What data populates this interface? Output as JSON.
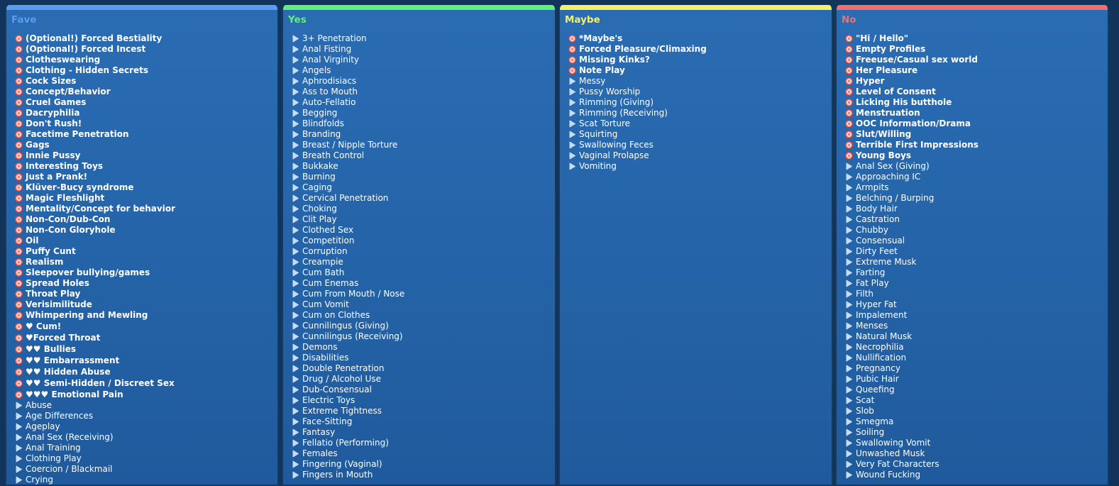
{
  "columns": [
    {
      "id": "fave",
      "title": "Fave",
      "color": "#5b9bf0",
      "items": [
        {
          "label": "(Optional!) Forced Bestiality",
          "bold": true,
          "icon": "red-circle-icon"
        },
        {
          "label": "(Optional!) Forced Incest",
          "bold": true,
          "icon": "red-circle-icon"
        },
        {
          "label": "Clotheswearing",
          "bold": true,
          "icon": "red-circle-icon"
        },
        {
          "label": "Clothing - Hidden Secrets",
          "bold": true,
          "icon": "red-circle-icon"
        },
        {
          "label": "Cock Sizes",
          "bold": true,
          "icon": "red-circle-icon"
        },
        {
          "label": "Concept/Behavior",
          "bold": true,
          "icon": "red-circle-icon"
        },
        {
          "label": "Cruel Games",
          "bold": true,
          "icon": "red-circle-icon"
        },
        {
          "label": "Dacryphilia",
          "bold": true,
          "icon": "red-circle-icon"
        },
        {
          "label": "Don't Rush!",
          "bold": true,
          "icon": "red-circle-icon"
        },
        {
          "label": "Facetime Penetration",
          "bold": true,
          "icon": "red-circle-icon"
        },
        {
          "label": "Gags",
          "bold": true,
          "icon": "red-circle-icon"
        },
        {
          "label": "Innie Pussy",
          "bold": true,
          "icon": "red-circle-icon"
        },
        {
          "label": "Interesting Toys",
          "bold": true,
          "icon": "red-circle-icon"
        },
        {
          "label": "Just a Prank!",
          "bold": true,
          "icon": "red-circle-icon"
        },
        {
          "label": "Klüver-Bucy syndrome",
          "bold": true,
          "icon": "red-circle-icon"
        },
        {
          "label": "Magic Fleshlight",
          "bold": true,
          "icon": "red-circle-icon"
        },
        {
          "label": "Mentality/Concept for behavior",
          "bold": true,
          "icon": "red-circle-icon"
        },
        {
          "label": "Non-Con/Dub-Con",
          "bold": true,
          "icon": "red-circle-icon"
        },
        {
          "label": "Non-Con Gloryhole",
          "bold": true,
          "icon": "red-circle-icon"
        },
        {
          "label": "Oil",
          "bold": true,
          "icon": "red-circle-icon"
        },
        {
          "label": "Puffy Cunt",
          "bold": true,
          "icon": "red-circle-icon"
        },
        {
          "label": "Realism",
          "bold": true,
          "icon": "red-circle-icon"
        },
        {
          "label": "Sleepover bullying/games",
          "bold": true,
          "icon": "red-circle-icon"
        },
        {
          "label": "Spread Holes",
          "bold": true,
          "icon": "red-circle-icon"
        },
        {
          "label": "Throat Play",
          "bold": true,
          "icon": "red-circle-icon"
        },
        {
          "label": "Verisimilitude",
          "bold": true,
          "icon": "red-circle-icon"
        },
        {
          "label": "Whimpering and Mewling",
          "bold": true,
          "icon": "red-circle-icon"
        },
        {
          "label": "♥ Cum!",
          "bold": true,
          "icon": "red-circle-icon",
          "tall": true
        },
        {
          "label": "♥Forced Throat",
          "bold": true,
          "icon": "red-circle-icon",
          "tall": true
        },
        {
          "label": "♥♥ Bullies",
          "bold": true,
          "icon": "red-circle-icon",
          "tall": true
        },
        {
          "label": "♥♥ Embarrassment",
          "bold": true,
          "icon": "red-circle-icon",
          "tall": true
        },
        {
          "label": "♥♥ Hidden Abuse",
          "bold": true,
          "icon": "red-circle-icon",
          "tall": true
        },
        {
          "label": "♥♥ Semi-Hidden / Discreet Sex",
          "bold": true,
          "icon": "red-circle-icon",
          "tall": true
        },
        {
          "label": "♥♥♥ Emotional Pain",
          "bold": true,
          "icon": "red-circle-icon",
          "tall": true
        },
        {
          "label": "Abuse",
          "bold": false,
          "icon": "blue-arrow-icon"
        },
        {
          "label": "Age Differences",
          "bold": false,
          "icon": "blue-arrow-icon"
        },
        {
          "label": "Ageplay",
          "bold": false,
          "icon": "blue-arrow-icon"
        },
        {
          "label": "Anal Sex (Receiving)",
          "bold": false,
          "icon": "blue-arrow-icon"
        },
        {
          "label": "Anal Training",
          "bold": false,
          "icon": "blue-arrow-icon"
        },
        {
          "label": "Clothing Play",
          "bold": false,
          "icon": "blue-arrow-icon"
        },
        {
          "label": "Coercion / Blackmail",
          "bold": false,
          "icon": "blue-arrow-icon"
        },
        {
          "label": "Crying",
          "bold": false,
          "icon": "blue-arrow-icon"
        }
      ]
    },
    {
      "id": "yes",
      "title": "Yes",
      "color": "#5ef07a",
      "items": [
        {
          "label": "3+ Penetration",
          "bold": false,
          "icon": "blue-arrow-icon"
        },
        {
          "label": "Anal Fisting",
          "bold": false,
          "icon": "blue-arrow-icon"
        },
        {
          "label": "Anal Virginity",
          "bold": false,
          "icon": "blue-arrow-icon"
        },
        {
          "label": "Angels",
          "bold": false,
          "icon": "blue-arrow-icon"
        },
        {
          "label": "Aphrodisiacs",
          "bold": false,
          "icon": "blue-arrow-icon"
        },
        {
          "label": "Ass to Mouth",
          "bold": false,
          "icon": "blue-arrow-icon"
        },
        {
          "label": "Auto-Fellatio",
          "bold": false,
          "icon": "blue-arrow-icon"
        },
        {
          "label": "Begging",
          "bold": false,
          "icon": "blue-arrow-icon"
        },
        {
          "label": "Blindfolds",
          "bold": false,
          "icon": "blue-arrow-icon"
        },
        {
          "label": "Branding",
          "bold": false,
          "icon": "blue-arrow-icon"
        },
        {
          "label": "Breast / Nipple Torture",
          "bold": false,
          "icon": "blue-arrow-icon"
        },
        {
          "label": "Breath Control",
          "bold": false,
          "icon": "blue-arrow-icon"
        },
        {
          "label": "Bukkake",
          "bold": false,
          "icon": "blue-arrow-icon"
        },
        {
          "label": "Burning",
          "bold": false,
          "icon": "blue-arrow-icon"
        },
        {
          "label": "Caging",
          "bold": false,
          "icon": "blue-arrow-icon"
        },
        {
          "label": "Cervical Penetration",
          "bold": false,
          "icon": "blue-arrow-icon"
        },
        {
          "label": "Choking",
          "bold": false,
          "icon": "blue-arrow-icon"
        },
        {
          "label": "Clit Play",
          "bold": false,
          "icon": "blue-arrow-icon"
        },
        {
          "label": "Clothed Sex",
          "bold": false,
          "icon": "blue-arrow-icon"
        },
        {
          "label": "Competition",
          "bold": false,
          "icon": "blue-arrow-icon"
        },
        {
          "label": "Corruption",
          "bold": false,
          "icon": "blue-arrow-icon"
        },
        {
          "label": "Creampie",
          "bold": false,
          "icon": "blue-arrow-icon"
        },
        {
          "label": "Cum Bath",
          "bold": false,
          "icon": "blue-arrow-icon"
        },
        {
          "label": "Cum Enemas",
          "bold": false,
          "icon": "blue-arrow-icon"
        },
        {
          "label": "Cum From Mouth / Nose",
          "bold": false,
          "icon": "blue-arrow-icon"
        },
        {
          "label": "Cum Vomit",
          "bold": false,
          "icon": "blue-arrow-icon"
        },
        {
          "label": "Cum on Clothes",
          "bold": false,
          "icon": "blue-arrow-icon"
        },
        {
          "label": "Cunnilingus (Giving)",
          "bold": false,
          "icon": "blue-arrow-icon"
        },
        {
          "label": "Cunnilingus (Receiving)",
          "bold": false,
          "icon": "blue-arrow-icon"
        },
        {
          "label": "Demons",
          "bold": false,
          "icon": "blue-arrow-icon"
        },
        {
          "label": "Disabilities",
          "bold": false,
          "icon": "blue-arrow-icon"
        },
        {
          "label": "Double Penetration",
          "bold": false,
          "icon": "blue-arrow-icon"
        },
        {
          "label": "Drug / Alcohol Use",
          "bold": false,
          "icon": "blue-arrow-icon"
        },
        {
          "label": "Dub-Consensual",
          "bold": false,
          "icon": "blue-arrow-icon"
        },
        {
          "label": "Electric Toys",
          "bold": false,
          "icon": "blue-arrow-icon"
        },
        {
          "label": "Extreme Tightness",
          "bold": false,
          "icon": "blue-arrow-icon"
        },
        {
          "label": "Face-Sitting",
          "bold": false,
          "icon": "blue-arrow-icon"
        },
        {
          "label": "Fantasy",
          "bold": false,
          "icon": "blue-arrow-icon"
        },
        {
          "label": "Fellatio (Performing)",
          "bold": false,
          "icon": "blue-arrow-icon"
        },
        {
          "label": "Females",
          "bold": false,
          "icon": "blue-arrow-icon"
        },
        {
          "label": "Fingering (Vaginal)",
          "bold": false,
          "icon": "blue-arrow-icon"
        },
        {
          "label": "Fingers in Mouth",
          "bold": false,
          "icon": "blue-arrow-icon"
        }
      ]
    },
    {
      "id": "maybe",
      "title": "Maybe",
      "color": "#f5f06a",
      "items": [
        {
          "label": "*Maybe's",
          "bold": true,
          "icon": "red-circle-icon"
        },
        {
          "label": "Forced Pleasure/Climaxing",
          "bold": true,
          "icon": "red-circle-icon"
        },
        {
          "label": "Missing Kinks?",
          "bold": true,
          "icon": "red-circle-icon"
        },
        {
          "label": "Note Play",
          "bold": true,
          "icon": "red-circle-icon"
        },
        {
          "label": "Messy",
          "bold": false,
          "icon": "blue-arrow-icon"
        },
        {
          "label": "Pussy Worship",
          "bold": false,
          "icon": "blue-arrow-icon"
        },
        {
          "label": "Rimming (Giving)",
          "bold": false,
          "icon": "blue-arrow-icon"
        },
        {
          "label": "Rimming (Receiving)",
          "bold": false,
          "icon": "blue-arrow-icon"
        },
        {
          "label": "Scat Torture",
          "bold": false,
          "icon": "blue-arrow-icon"
        },
        {
          "label": "Squirting",
          "bold": false,
          "icon": "blue-arrow-icon"
        },
        {
          "label": "Swallowing Feces",
          "bold": false,
          "icon": "blue-arrow-icon"
        },
        {
          "label": "Vaginal Prolapse",
          "bold": false,
          "icon": "blue-arrow-icon"
        },
        {
          "label": "Vomiting",
          "bold": false,
          "icon": "blue-arrow-icon"
        }
      ]
    },
    {
      "id": "no",
      "title": "No",
      "color": "#f07070",
      "items": [
        {
          "label": "\"Hi / Hello\"",
          "bold": true,
          "icon": "red-circle-icon"
        },
        {
          "label": "Empty Profiles",
          "bold": true,
          "icon": "red-circle-icon"
        },
        {
          "label": "Freeuse/Casual sex world",
          "bold": true,
          "icon": "red-circle-icon"
        },
        {
          "label": "Her Pleasure",
          "bold": true,
          "icon": "red-circle-icon"
        },
        {
          "label": "Hyper",
          "bold": true,
          "icon": "red-circle-icon"
        },
        {
          "label": "Level of Consent",
          "bold": true,
          "icon": "red-circle-icon"
        },
        {
          "label": "Licking His butthole",
          "bold": true,
          "icon": "red-circle-icon"
        },
        {
          "label": "Menstruation",
          "bold": true,
          "icon": "red-circle-icon"
        },
        {
          "label": "OOC Information/Drama",
          "bold": true,
          "icon": "red-circle-icon"
        },
        {
          "label": "Slut/Willing",
          "bold": true,
          "icon": "red-circle-icon"
        },
        {
          "label": "Terrible First Impressions",
          "bold": true,
          "icon": "red-circle-icon"
        },
        {
          "label": "Young Boys",
          "bold": true,
          "icon": "red-circle-icon"
        },
        {
          "label": "Anal Sex (Giving)",
          "bold": false,
          "icon": "blue-arrow-icon"
        },
        {
          "label": "Approaching IC",
          "bold": false,
          "icon": "blue-arrow-icon"
        },
        {
          "label": "Armpits",
          "bold": false,
          "icon": "blue-arrow-icon"
        },
        {
          "label": "Belching / Burping",
          "bold": false,
          "icon": "blue-arrow-icon"
        },
        {
          "label": "Body Hair",
          "bold": false,
          "icon": "blue-arrow-icon"
        },
        {
          "label": "Castration",
          "bold": false,
          "icon": "blue-arrow-icon"
        },
        {
          "label": "Chubby",
          "bold": false,
          "icon": "blue-arrow-icon"
        },
        {
          "label": "Consensual",
          "bold": false,
          "icon": "blue-arrow-icon"
        },
        {
          "label": "Dirty Feet",
          "bold": false,
          "icon": "blue-arrow-icon"
        },
        {
          "label": "Extreme Musk",
          "bold": false,
          "icon": "blue-arrow-icon"
        },
        {
          "label": "Farting",
          "bold": false,
          "icon": "blue-arrow-icon"
        },
        {
          "label": "Fat Play",
          "bold": false,
          "icon": "blue-arrow-icon"
        },
        {
          "label": "Filth",
          "bold": false,
          "icon": "blue-arrow-icon"
        },
        {
          "label": "Hyper Fat",
          "bold": false,
          "icon": "blue-arrow-icon"
        },
        {
          "label": "Impalement",
          "bold": false,
          "icon": "blue-arrow-icon"
        },
        {
          "label": "Menses",
          "bold": false,
          "icon": "blue-arrow-icon"
        },
        {
          "label": "Natural Musk",
          "bold": false,
          "icon": "blue-arrow-icon"
        },
        {
          "label": "Necrophilia",
          "bold": false,
          "icon": "blue-arrow-icon"
        },
        {
          "label": "Nullification",
          "bold": false,
          "icon": "blue-arrow-icon"
        },
        {
          "label": "Pregnancy",
          "bold": false,
          "icon": "blue-arrow-icon"
        },
        {
          "label": "Pubic Hair",
          "bold": false,
          "icon": "blue-arrow-icon"
        },
        {
          "label": "Queefing",
          "bold": false,
          "icon": "blue-arrow-icon"
        },
        {
          "label": "Scat",
          "bold": false,
          "icon": "blue-arrow-icon"
        },
        {
          "label": "Slob",
          "bold": false,
          "icon": "blue-arrow-icon"
        },
        {
          "label": "Smegma",
          "bold": false,
          "icon": "blue-arrow-icon"
        },
        {
          "label": "Soiling",
          "bold": false,
          "icon": "blue-arrow-icon"
        },
        {
          "label": "Swallowing Vomit",
          "bold": false,
          "icon": "blue-arrow-icon"
        },
        {
          "label": "Unwashed Musk",
          "bold": false,
          "icon": "blue-arrow-icon"
        },
        {
          "label": "Very Fat Characters",
          "bold": false,
          "icon": "blue-arrow-icon"
        },
        {
          "label": "Wound Fucking",
          "bold": false,
          "icon": "blue-arrow-icon"
        }
      ]
    }
  ]
}
